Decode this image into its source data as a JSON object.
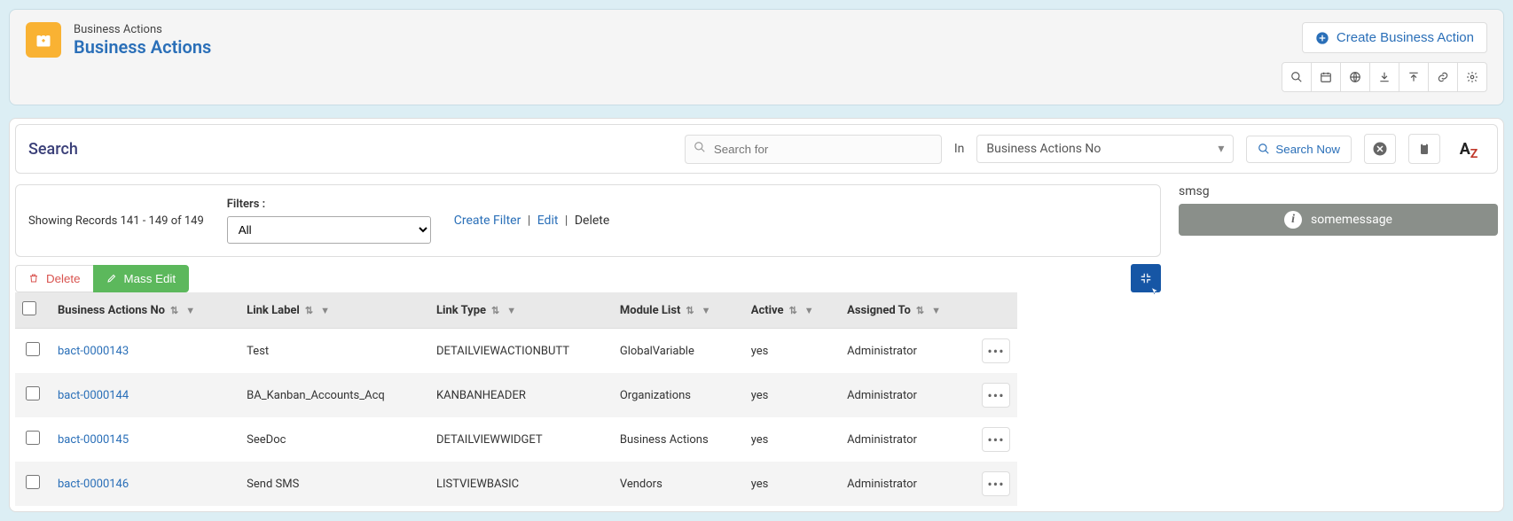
{
  "header": {
    "breadcrumb": "Business Actions",
    "title": "Business Actions",
    "create_label": "Create Business Action"
  },
  "search": {
    "label": "Search",
    "placeholder": "Search for",
    "in_label": "In",
    "in_field": "Business Actions No",
    "search_now": "Search Now"
  },
  "filters": {
    "records_text": "Showing Records 141 - 149 of 149",
    "label": "Filters :",
    "selected": "All",
    "create": "Create Filter",
    "edit": "Edit",
    "delete": "Delete"
  },
  "side": {
    "label": "smsg",
    "text": "somemessage"
  },
  "actions": {
    "delete": "Delete",
    "mass_edit": "Mass Edit"
  },
  "columns": {
    "ba_no": "Business Actions No",
    "link_label": "Link Label",
    "link_type": "Link Type",
    "module_list": "Module List",
    "active": "Active",
    "assigned_to": "Assigned To"
  },
  "rows": [
    {
      "ba_no": "bact-0000143",
      "link_label": "Test",
      "link_type": "DETAILVIEWACTIONBUTT",
      "module_list": "GlobalVariable",
      "active": "yes",
      "assigned_to": "Administrator"
    },
    {
      "ba_no": "bact-0000144",
      "link_label": "BA_Kanban_Accounts_Acq",
      "link_type": "KANBANHEADER",
      "module_list": "Organizations",
      "active": "yes",
      "assigned_to": "Administrator"
    },
    {
      "ba_no": "bact-0000145",
      "link_label": "SeeDoc",
      "link_type": "DETAILVIEWWIDGET",
      "module_list": "Business Actions",
      "active": "yes",
      "assigned_to": "Administrator"
    },
    {
      "ba_no": "bact-0000146",
      "link_label": "Send SMS",
      "link_type": "LISTVIEWBASIC",
      "module_list": "Vendors",
      "active": "yes",
      "assigned_to": "Administrator"
    }
  ]
}
